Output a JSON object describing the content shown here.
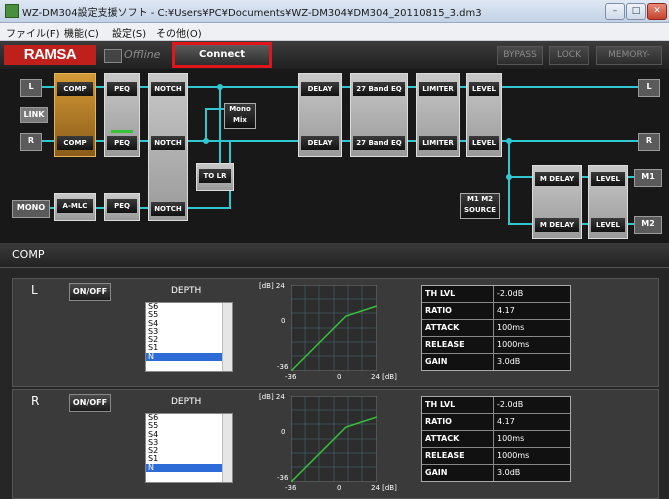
{
  "window": {
    "title": "WZ-DM304設定支援ソフト - C:¥Users¥PC¥Documents¥WZ-DM304¥DM304_20110815_3.dm3",
    "buttons": [
      "–",
      "□",
      "✕"
    ]
  },
  "menu": [
    "ファイル(F)",
    "機能(C)",
    "設定(S)",
    "その他(O)"
  ],
  "header": {
    "logo": "RAMSA",
    "status": "Offline",
    "connect_label": "Connect",
    "bypass_label": "BYPASS",
    "lock_label": "LOCK",
    "memory_label": "MEMORY-"
  },
  "routing": {
    "inputs": {
      "l": "L",
      "link": "LINK",
      "r": "R",
      "mono": "MONO"
    },
    "outputs": {
      "l": "L",
      "r": "R",
      "m1": "M1",
      "m2": "M2"
    },
    "blocks": {
      "comp_l": "COMP",
      "comp_r": "COMP",
      "peq_l": "PEQ",
      "peq_r": "PEQ",
      "peq_mono": "PEQ",
      "notch_l": "NOTCH",
      "notch_r": "NOTCH",
      "notch_mono": "NOTCH",
      "amlc": "A-MLC",
      "mono_mix": "Mono Mix",
      "to_lr": "TO LR",
      "delay_l": "DELAY",
      "delay_r": "DELAY",
      "eq27_l": "27 Band EQ",
      "eq27_r": "27 Band EQ",
      "limiter_l": "LIMITER",
      "limiter_r": "LIMITER",
      "level_l": "LEVEL",
      "level_r": "LEVEL",
      "m1m2_source": "M1 M2 SOURCE",
      "mdelay_1": "M DELAY",
      "mdelay_2": "M DELAY",
      "level_m1": "LEVEL",
      "level_m2": "LEVEL"
    }
  },
  "section_title": "COMP",
  "channels": [
    {
      "name": "L",
      "onoff_label": "ON/OFF",
      "depth_label": "DEPTH",
      "depth_options": [
        "S6",
        "S5",
        "S4",
        "S3",
        "S2",
        "S1",
        "N"
      ],
      "depth_selected": "N",
      "graph": {
        "unit_top": "[dB] 24",
        "y_zero": "0",
        "y_min": "-36",
        "x_min": "-36",
        "x_zero": "0",
        "x_max": "24 [dB]"
      },
      "params": [
        {
          "key": "TH LVL",
          "value": "-2.0dB"
        },
        {
          "key": "RATIO",
          "value": "4.17"
        },
        {
          "key": "ATTACK",
          "value": "100ms"
        },
        {
          "key": "RELEASE",
          "value": "1000ms"
        },
        {
          "key": "GAIN",
          "value": "3.0dB"
        }
      ]
    },
    {
      "name": "R",
      "onoff_label": "ON/OFF",
      "depth_label": "DEPTH",
      "depth_options": [
        "S6",
        "S5",
        "S4",
        "S3",
        "S2",
        "S1",
        "N"
      ],
      "depth_selected": "N",
      "graph": {
        "unit_top": "[dB] 24",
        "y_zero": "0",
        "y_min": "-36",
        "x_min": "-36",
        "x_zero": "0",
        "x_max": "24 [dB]"
      },
      "params": [
        {
          "key": "TH LVL",
          "value": "-2.0dB"
        },
        {
          "key": "RATIO",
          "value": "4.17"
        },
        {
          "key": "ATTACK",
          "value": "100ms"
        },
        {
          "key": "RELEASE",
          "value": "1000ms"
        },
        {
          "key": "GAIN",
          "value": "3.0dB"
        }
      ]
    }
  ],
  "colors": {
    "accent_line": "#31c6d0",
    "comp_active": "#b8872e",
    "connect_border": "#e0161b",
    "logo_red": "#c0201c",
    "curve": "#37c23a"
  }
}
